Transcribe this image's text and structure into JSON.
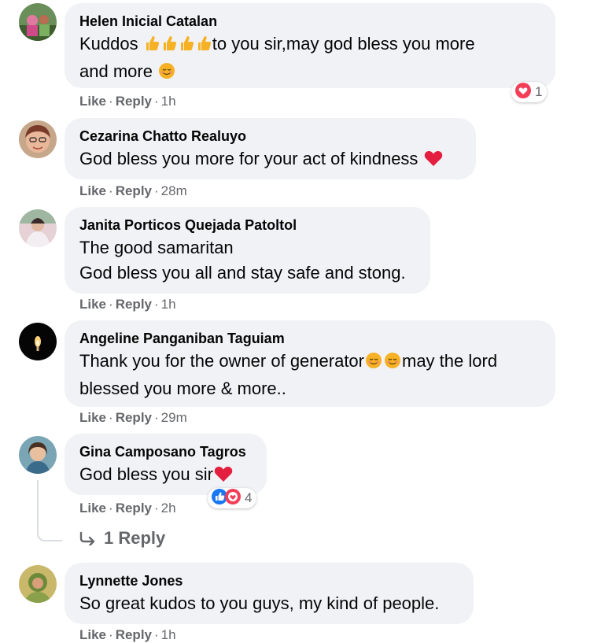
{
  "comments": [
    {
      "author": "Helen Inicial Catalan",
      "text_lines": [
        "Kuddos",
        "to you sir,may god bless you more",
        "and more"
      ],
      "like": "Like",
      "reply": "Reply",
      "time": "1h",
      "reaction_count": "1"
    },
    {
      "author": "Cezarina Chatto Realuyo",
      "text": "God bless you more for your act of kindness",
      "like": "Like",
      "reply": "Reply",
      "time": "28m"
    },
    {
      "author": "Janita Porticos Quejada Patoltol",
      "text_lines": [
        "The good samaritan",
        "God bless you all and stay safe and stong."
      ],
      "like": "Like",
      "reply": "Reply",
      "time": "1h"
    },
    {
      "author": "Angeline Panganiban Taguiam",
      "text_lines": [
        "Thank you for the owner of generator",
        "may the lord",
        "blessed you more & more.."
      ],
      "like": "Like",
      "reply": "Reply",
      "time": "29m"
    },
    {
      "author": "Gina Camposano Tagros",
      "text": "God bless you sir",
      "like": "Like",
      "reply": "Reply",
      "time": "2h",
      "reaction_count": "4",
      "replies_label": "1 Reply"
    },
    {
      "author": "Lynnette Jones",
      "text": "So great kudos to you guys, my kind of people.",
      "like": "Like",
      "reply": "Reply",
      "time": "1h"
    }
  ],
  "separator": "·",
  "colors": {
    "bubble": "#f0f2f5",
    "meta": "#65676b",
    "love": "#f33e58",
    "like": "#1877f2",
    "care": "#f7b125"
  },
  "icons": [
    "thumbs-up-emoji",
    "relieved-face-emoji",
    "red-heart-emoji",
    "love-reaction-icon",
    "like-reaction-icon",
    "care-reaction-icon",
    "reply-arrow-icon"
  ]
}
